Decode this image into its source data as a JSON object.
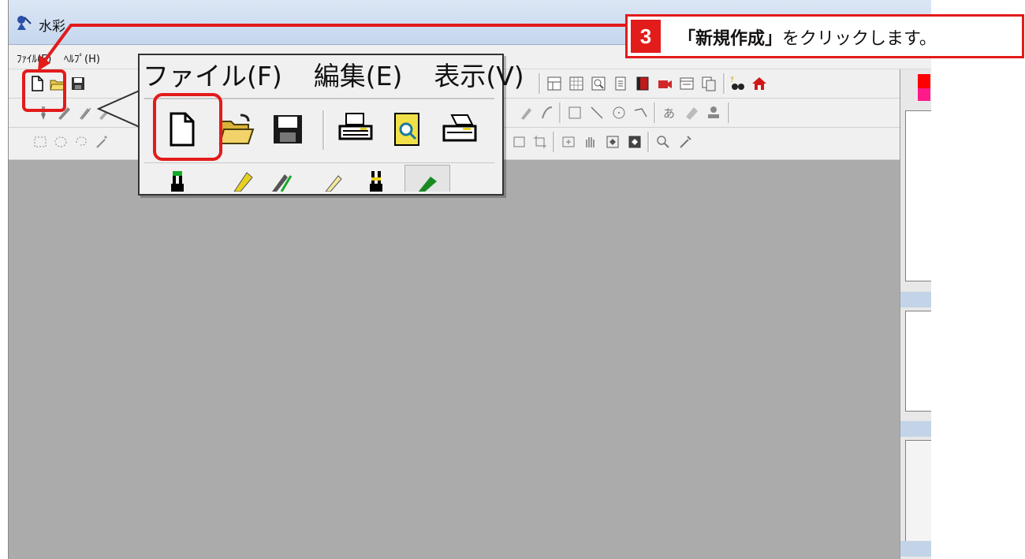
{
  "window": {
    "title": "水彩"
  },
  "menubar": {
    "items": [
      "ﾌｧｲﾙ(E)",
      "ﾍﾙﾌﾟ(H)"
    ]
  },
  "callout": {
    "menu": [
      "ファイル(F)",
      "編集(E)",
      "表示(V)"
    ]
  },
  "instruction": {
    "step": "3",
    "highlight": "「新規作成」",
    "text": "をクリックします。"
  },
  "colors": {
    "accent": "#e21b1b",
    "workspace": "#ababab"
  }
}
